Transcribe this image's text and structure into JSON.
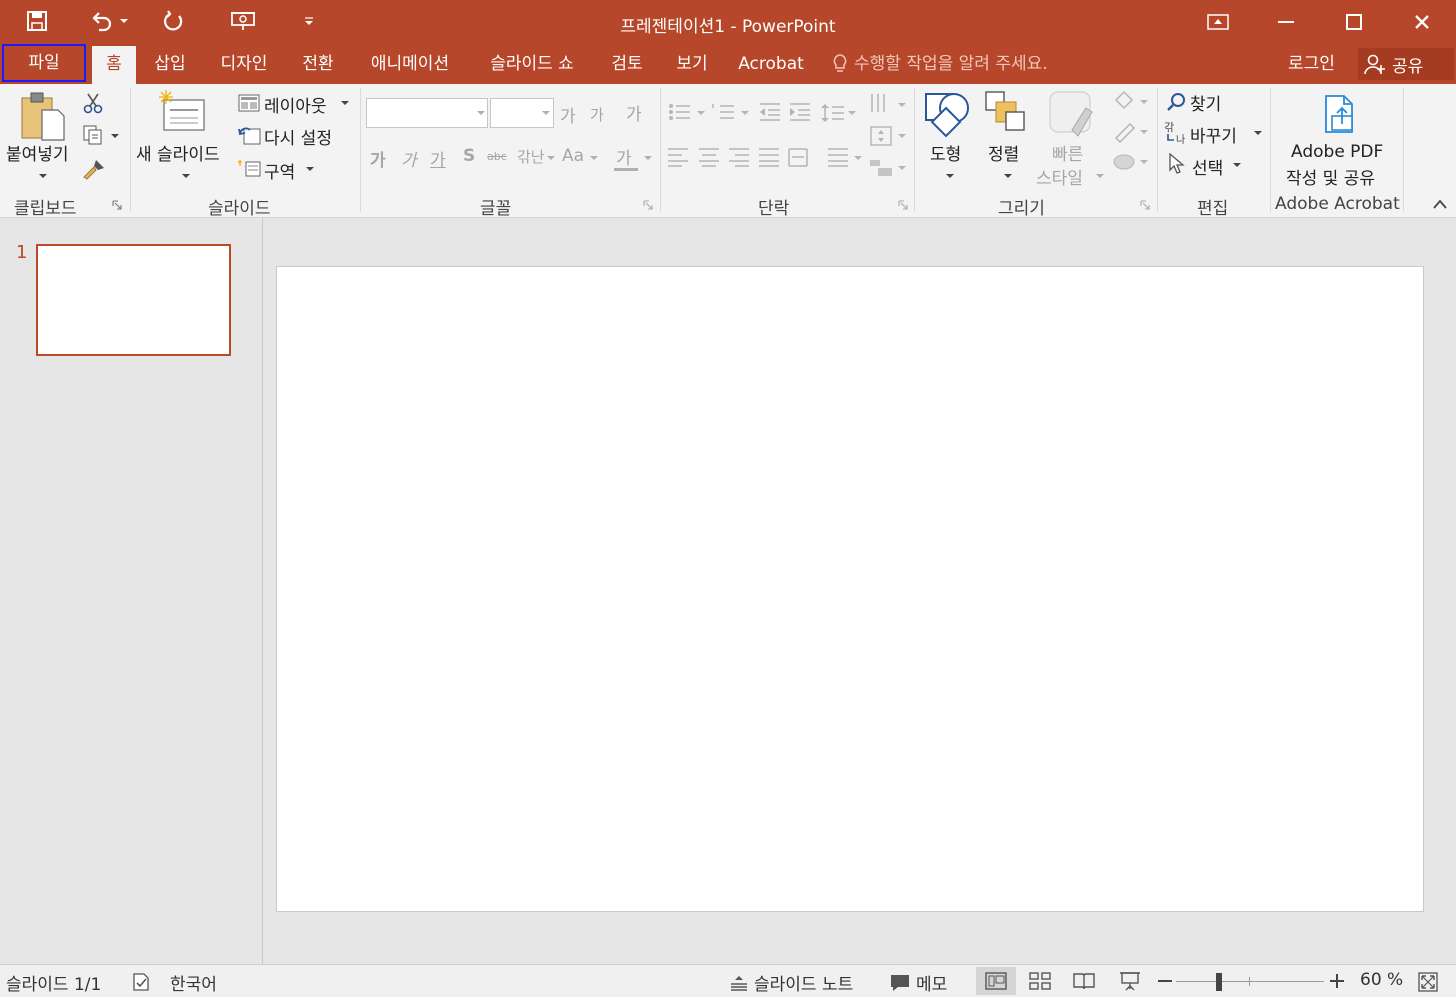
{
  "window": {
    "title": "프레젠테이션1 - PowerPoint"
  },
  "quick_access": {
    "icons": [
      "save-icon",
      "undo-icon",
      "undo-dropdown-icon",
      "redo-icon",
      "presentation-icon",
      "customize-icon"
    ]
  },
  "tabs": [
    {
      "label": "파일"
    },
    {
      "label": "홈"
    },
    {
      "label": "삽입"
    },
    {
      "label": "디자인"
    },
    {
      "label": "전환"
    },
    {
      "label": "애니메이션"
    },
    {
      "label": "슬라이드 쇼"
    },
    {
      "label": "검토"
    },
    {
      "label": "보기"
    },
    {
      "label": "Acrobat"
    }
  ],
  "tell_me": "수행할 작업을 알려 주세요.",
  "account": {
    "login": "로그인",
    "share": "공유"
  },
  "ribbon": {
    "clipboard": {
      "paste": "붙여넣기",
      "label": "클립보드"
    },
    "slides": {
      "new_slide": "새 슬라이드",
      "layout": "레이아웃",
      "reset": "다시 설정",
      "section": "구역",
      "label": "슬라이드"
    },
    "font": {
      "grow": "가",
      "shrink": "가",
      "clear": "가",
      "bold": "가",
      "italic": "가",
      "underline": "가",
      "shadow": "S",
      "strike": "abc",
      "spacing": "갂난",
      "case": "Aa",
      "color": "가",
      "label": "글꼴"
    },
    "paragraph": {
      "label": "단락"
    },
    "drawing": {
      "shapes": "도형",
      "arrange": "정렬",
      "quick_styles_1": "빠른",
      "quick_styles_2": "스타일",
      "label": "그리기"
    },
    "editing": {
      "find": "찾기",
      "replace": "바꾸기",
      "select": "선택",
      "label": "편집"
    },
    "acrobat": {
      "line1": "Adobe PDF",
      "line2": "작성 및 공유",
      "label": "Adobe Acrobat"
    }
  },
  "slides_pane": {
    "slide_number": "1"
  },
  "status_bar": {
    "slide_info": "슬라이드 1/1",
    "language": "한국어",
    "notes": "슬라이드 노트",
    "comments": "메모",
    "zoom": "60 %"
  },
  "colors": {
    "accent": "#b7472a",
    "ribbon_bg": "#f3f3f3",
    "workspace_bg": "#e6e6e6"
  }
}
